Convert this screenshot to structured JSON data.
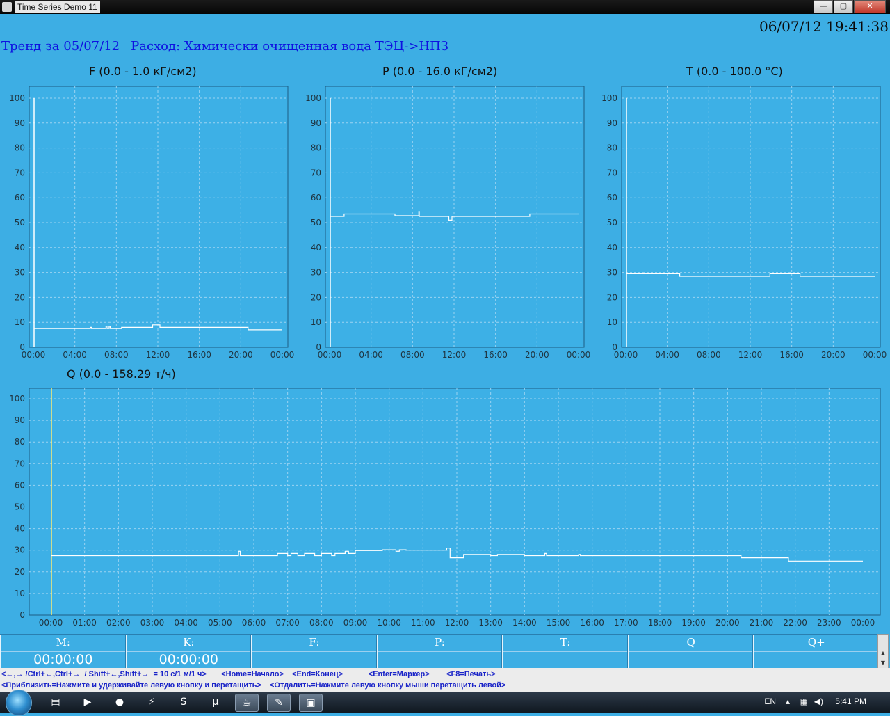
{
  "window": {
    "title": "Time Series Demo 11",
    "minimize": "—",
    "maximize": "▢",
    "close": "✕"
  },
  "clock": "06/07/12 19:41:38",
  "header": {
    "trend": "Тренд за 05/07/12",
    "flow": "Расход: Химически очищенная вода ТЭЦ->НПЗ"
  },
  "chart_data": [
    {
      "type": "line",
      "title": "F  (0.0 - 1.0 кГ/см2)",
      "x_ticks": [
        "00:00",
        "04:00",
        "08:00",
        "12:00",
        "16:00",
        "20:00",
        "00:00"
      ],
      "y_ticks": [
        0,
        10,
        20,
        30,
        40,
        50,
        60,
        70,
        80,
        90,
        100
      ],
      "ylim": [
        0,
        100
      ],
      "xlim_hours": [
        0,
        24
      ],
      "start_spike": [
        0,
        100
      ],
      "grid": true,
      "series": [
        {
          "points": [
            [
              0.05,
              7.5
            ],
            [
              5.5,
              7.5
            ],
            [
              5.5,
              8
            ],
            [
              5.6,
              8
            ],
            [
              5.6,
              7.5
            ],
            [
              7.0,
              7.5
            ],
            [
              7.0,
              8.5
            ],
            [
              7.1,
              8.5
            ],
            [
              7.1,
              7.5
            ],
            [
              7.3,
              7.5
            ],
            [
              7.3,
              8.5
            ],
            [
              7.4,
              8.5
            ],
            [
              7.4,
              7.5
            ],
            [
              8.5,
              7.5
            ],
            [
              8.5,
              8
            ],
            [
              11.5,
              8
            ],
            [
              11.5,
              9
            ],
            [
              12.2,
              9
            ],
            [
              12.2,
              8
            ],
            [
              20.7,
              8
            ],
            [
              20.7,
              7
            ],
            [
              24,
              7
            ]
          ]
        }
      ]
    },
    {
      "type": "line",
      "title": "P  (0.0 - 16.0 кГ/см2)",
      "x_ticks": [
        "00:00",
        "04:00",
        "08:00",
        "12:00",
        "16:00",
        "20:00",
        "00:00"
      ],
      "y_ticks": [
        0,
        10,
        20,
        30,
        40,
        50,
        60,
        70,
        80,
        90,
        100
      ],
      "ylim": [
        0,
        100
      ],
      "xlim_hours": [
        0,
        24
      ],
      "start_spike": [
        0,
        100
      ],
      "grid": true,
      "series": [
        {
          "points": [
            [
              0.05,
              52.5
            ],
            [
              1.4,
              52.5
            ],
            [
              1.4,
              53.5
            ],
            [
              6.3,
              53.5
            ],
            [
              6.3,
              52.8
            ],
            [
              8.6,
              52.8
            ],
            [
              8.6,
              54.5
            ],
            [
              8.65,
              54.5
            ],
            [
              8.65,
              52.5
            ],
            [
              11.5,
              52.5
            ],
            [
              11.5,
              51
            ],
            [
              11.8,
              51
            ],
            [
              11.8,
              52.5
            ],
            [
              19.3,
              52.5
            ],
            [
              19.3,
              53.5
            ],
            [
              24,
              53.5
            ]
          ]
        }
      ]
    },
    {
      "type": "line",
      "title": "T  (0.0 - 100.0 °C)",
      "x_ticks": [
        "00:00",
        "04:00",
        "08:00",
        "12:00",
        "16:00",
        "20:00",
        "00:00"
      ],
      "y_ticks": [
        0,
        10,
        20,
        30,
        40,
        50,
        60,
        70,
        80,
        90,
        100
      ],
      "ylim": [
        0,
        100
      ],
      "xlim_hours": [
        0,
        24
      ],
      "start_spike": [
        0,
        100
      ],
      "grid": true,
      "series": [
        {
          "points": [
            [
              0.05,
              29.5
            ],
            [
              5.2,
              29.5
            ],
            [
              5.2,
              28.5
            ],
            [
              13.9,
              28.5
            ],
            [
              13.9,
              29.5
            ],
            [
              16.8,
              29.5
            ],
            [
              16.8,
              28.5
            ],
            [
              24,
              28.5
            ]
          ]
        }
      ]
    },
    {
      "type": "line",
      "title": "Q  (0.0 - 158.29 т/ч)",
      "x_ticks": [
        "00:00",
        "01:00",
        "02:00",
        "03:00",
        "04:00",
        "05:00",
        "06:00",
        "07:00",
        "08:00",
        "09:00",
        "10:00",
        "11:00",
        "12:00",
        "13:00",
        "14:00",
        "15:00",
        "16:00",
        "17:00",
        "18:00",
        "19:00",
        "20:00",
        "21:00",
        "22:00",
        "23:00",
        "00:00"
      ],
      "y_ticks": [
        0,
        10,
        20,
        30,
        40,
        50,
        60,
        70,
        80,
        90,
        100
      ],
      "ylim": [
        0,
        100
      ],
      "xlim_hours": [
        0,
        24
      ],
      "marker_time": "00:00",
      "grid": true,
      "series": [
        {
          "points": [
            [
              0.02,
              27.5
            ],
            [
              5.55,
              27.5
            ],
            [
              5.55,
              29.5
            ],
            [
              5.6,
              29.5
            ],
            [
              5.6,
              27.5
            ],
            [
              6.7,
              27.5
            ],
            [
              6.7,
              28.5
            ],
            [
              7.0,
              28.5
            ],
            [
              7.0,
              27.5
            ],
            [
              7.1,
              27.5
            ],
            [
              7.1,
              28.5
            ],
            [
              7.3,
              28.5
            ],
            [
              7.3,
              27.5
            ],
            [
              7.5,
              27.5
            ],
            [
              7.5,
              28.5
            ],
            [
              7.8,
              28.5
            ],
            [
              7.8,
              27.5
            ],
            [
              8.0,
              27.5
            ],
            [
              8.0,
              28.5
            ],
            [
              8.3,
              28.5
            ],
            [
              8.3,
              27.5
            ],
            [
              8.4,
              27.5
            ],
            [
              8.4,
              28.5
            ],
            [
              8.7,
              28.5
            ],
            [
              8.7,
              29.5
            ],
            [
              8.8,
              29.5
            ],
            [
              8.8,
              28.5
            ],
            [
              9.0,
              28.5
            ],
            [
              9.0,
              29.8
            ],
            [
              9.8,
              29.8
            ],
            [
              9.8,
              30.2
            ],
            [
              10.2,
              30.2
            ],
            [
              10.2,
              29.5
            ],
            [
              10.3,
              29.5
            ],
            [
              10.3,
              30.2
            ],
            [
              10.5,
              30.2
            ],
            [
              10.5,
              30
            ],
            [
              11.7,
              30
            ],
            [
              11.7,
              31
            ],
            [
              11.8,
              31
            ],
            [
              11.8,
              26.5
            ],
            [
              12.2,
              26.5
            ],
            [
              12.2,
              28
            ],
            [
              13.0,
              28
            ],
            [
              13.0,
              27.5
            ],
            [
              13.2,
              27.5
            ],
            [
              13.2,
              28
            ],
            [
              14.0,
              28
            ],
            [
              14.0,
              27.5
            ],
            [
              14.6,
              27.5
            ],
            [
              14.6,
              28.5
            ],
            [
              14.65,
              28.5
            ],
            [
              14.65,
              27.5
            ],
            [
              15.6,
              27.5
            ],
            [
              15.6,
              28
            ],
            [
              15.65,
              28
            ],
            [
              15.65,
              27.5
            ],
            [
              20.4,
              27.5
            ],
            [
              20.4,
              26.5
            ],
            [
              21.8,
              26.5
            ],
            [
              21.8,
              25
            ],
            [
              24,
              25
            ]
          ]
        }
      ]
    }
  ],
  "status": {
    "labels": [
      "M:",
      "K:",
      "F:",
      "P:",
      "T:",
      "Q",
      "Q+"
    ],
    "values": [
      "00:00:00",
      "00:00:00",
      "",
      "",
      "",
      "",
      ""
    ]
  },
  "help": {
    "line1": "<←,→ /Ctrl+←,Ctrl+→  / Shift+←,Shift+→  = 10 с/1 м/1 ч>       <Home=Начало>    <End=Конец>            <Enter=Маркер>        <F8=Печать>",
    "line2": "<Приблизить=Нажмите и удерживайте левую кнопку и перетащить>    <Отдалить=Нажмите левую кнопку мыши перетащить левой>"
  },
  "taskbar": {
    "lang": "EN",
    "time": "5:41 PM"
  }
}
